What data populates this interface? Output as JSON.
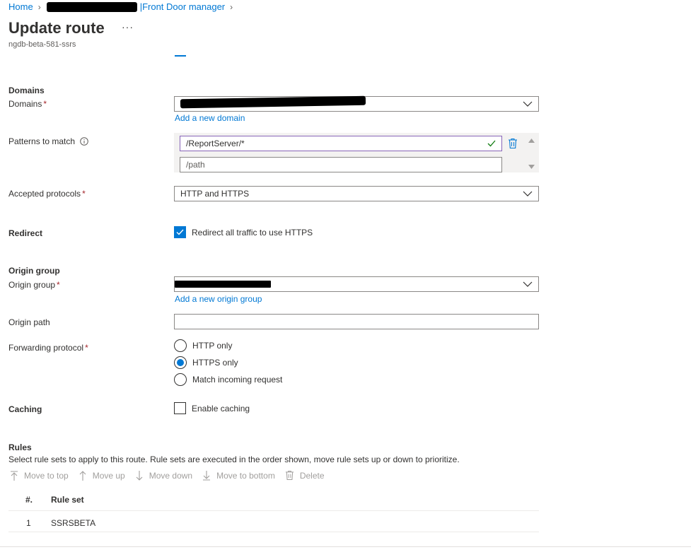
{
  "breadcrumb": {
    "home": "Home",
    "current": "Front Door manager"
  },
  "page": {
    "title": "Update route",
    "more": "···",
    "subtitle": "ngdb-beta-581-ssrs"
  },
  "domains": {
    "section_title": "Domains",
    "label": "Domains",
    "required_mark": "*",
    "add_link": "Add a new domain"
  },
  "patterns": {
    "label": "Patterns to match",
    "values": [
      "/ReportServer/*"
    ],
    "placeholder": "/path"
  },
  "protocols": {
    "label": "Accepted protocols",
    "required_mark": "*",
    "value": "HTTP and HTTPS"
  },
  "redirect": {
    "label": "Redirect",
    "checkbox_label": "Redirect all traffic to use HTTPS",
    "checked": true
  },
  "origin": {
    "section_title": "Origin group",
    "label": "Origin group",
    "required_mark": "*",
    "add_link": "Add a new origin group",
    "path_label": "Origin path",
    "path_value": ""
  },
  "forwarding": {
    "label": "Forwarding protocol",
    "required_mark": "*",
    "options": [
      "HTTP only",
      "HTTPS only",
      "Match incoming request"
    ],
    "selected": "HTTPS only"
  },
  "caching": {
    "label": "Caching",
    "checkbox_label": "Enable caching",
    "checked": false
  },
  "rules": {
    "section_title": "Rules",
    "description": "Select rule sets to apply to this route. Rule sets are executed in the order shown, move rule sets up or down to prioritize.",
    "toolbar": {
      "move_top": "Move to top",
      "move_up": "Move up",
      "move_down": "Move down",
      "move_bottom": "Move to bottom",
      "delete": "Delete"
    },
    "columns": [
      "#.",
      "Rule set"
    ],
    "rows": [
      {
        "num": "1",
        "name": "SSRSBETA"
      }
    ]
  },
  "colors": {
    "accent": "#0078d4",
    "required": "#a4262c",
    "valid_check": "#107c10",
    "focus_border": "#8764b8"
  },
  "icons": {
    "info": "info-icon",
    "delete": "trash-icon",
    "valid": "checkmark-icon",
    "dropdown": "chevron-down-icon"
  }
}
